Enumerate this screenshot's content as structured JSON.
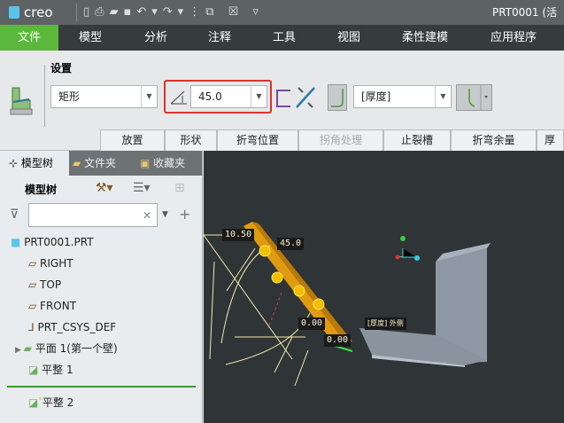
{
  "title": {
    "app": "creo",
    "document": "PRT0001 (活"
  },
  "menu": [
    "文件",
    "模型",
    "分析",
    "注释",
    "工具",
    "视图",
    "柔性建模",
    "应用程序"
  ],
  "ribbon": {
    "group_label": "设置",
    "shape_value": "矩形",
    "angle_value": "45.0",
    "thickness_value": "[厚度]"
  },
  "tabs": [
    "放置",
    "形状",
    "折弯位置",
    "拐角处理",
    "止裂槽",
    "折弯余量",
    "厚"
  ],
  "left_panel": {
    "tabs": [
      "模型树",
      "文件夹",
      "收藏夹"
    ],
    "header": "模型树",
    "search_placeholder": "",
    "tree": [
      {
        "label": "PRT0001.PRT"
      },
      {
        "label": "RIGHT"
      },
      {
        "label": "TOP"
      },
      {
        "label": "FRONT"
      },
      {
        "label": "PRT_CSYS_DEF"
      },
      {
        "label": "平面 1(第一个壁)"
      },
      {
        "label": "平整 1"
      },
      {
        "label": "平整 2",
        "marker": "*"
      }
    ]
  },
  "viewport": {
    "dims": [
      "10.50",
      "45.0",
      "0.00",
      "0.00"
    ],
    "side_label": "[厚度] 外侧"
  },
  "colors": {
    "accent": "#5cb83c",
    "highlight": "#e8a010",
    "alert": "#e03030"
  }
}
